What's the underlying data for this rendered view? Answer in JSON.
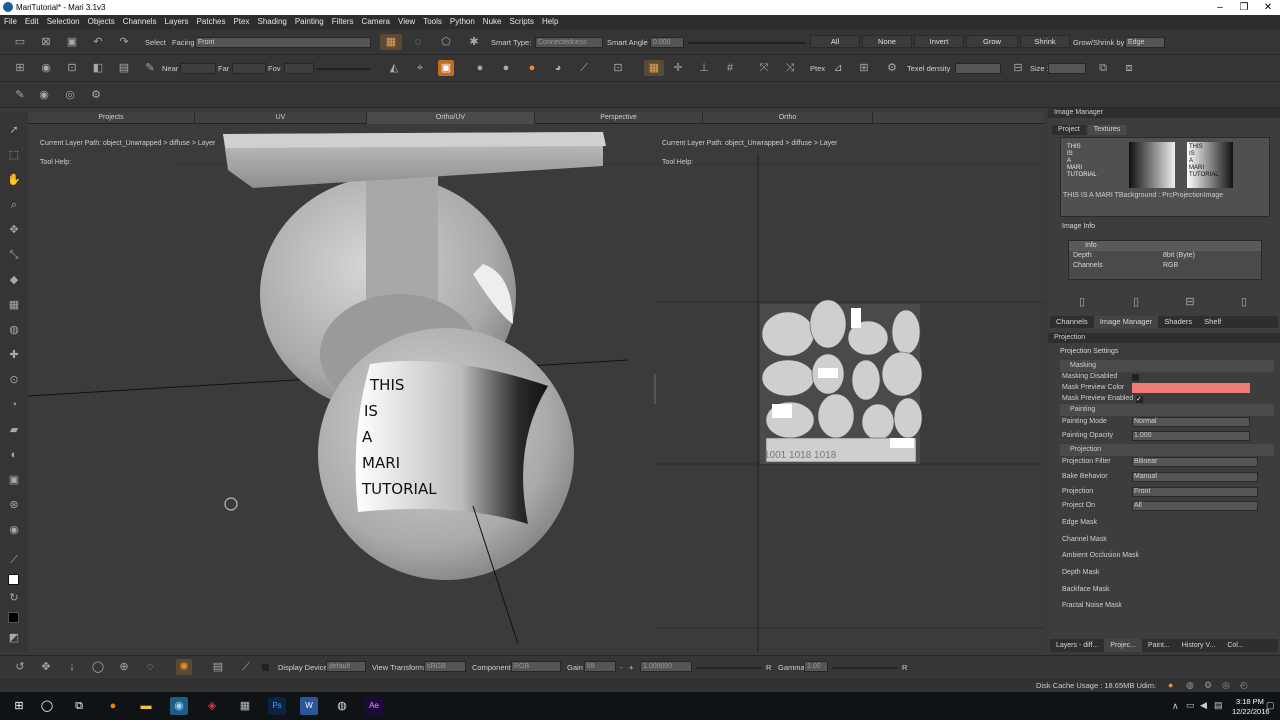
{
  "window": {
    "title": "MariTutorial* - Mari 3.1v3",
    "controls": [
      "minimize-icon",
      "maximize-icon",
      "close-icon"
    ]
  },
  "menu": [
    "File",
    "Edit",
    "Selection",
    "Objects",
    "Channels",
    "Layers",
    "Patches",
    "Ptex",
    "Shading",
    "Painting",
    "Filters",
    "Camera",
    "View",
    "Tools",
    "Python",
    "Nuke",
    "Scripts",
    "Help"
  ],
  "toolbar1": {
    "select_label": "Select",
    "facing_label": "Facing",
    "facing_value": "Front",
    "smart_type_label": "Smart Type:",
    "smart_type_value": "Connectedness",
    "smart_angle_label": "Smart Angle",
    "smart_angle_value": "0.000",
    "buttons": [
      "All",
      "None",
      "Invert",
      "Grow",
      "Shrink"
    ],
    "grow_shrink_label": "Grow/Shrink by",
    "grow_shrink_value": "Edge"
  },
  "toolbar2": {
    "near_label": "Near",
    "far_label": "Far",
    "fov_label": "Fov",
    "ptex_label": "Ptex",
    "texel_label": "Texel density",
    "size_label": "Size :"
  },
  "view_tabs": [
    "Projects",
    "UV",
    "Ortho/UV",
    "Perspective",
    "Ortho"
  ],
  "viewport": {
    "left_path": "Current Layer Path: object_Unwrapped > diffuse > Layer",
    "left_help": "Tool Help:",
    "right_path": "Current Layer Path: object_Unwrapped > diffuse > Layer",
    "right_help": "Tool Help:",
    "decal_lines": [
      "THIS",
      "IS",
      "A",
      "MARI",
      "TUTORIAL"
    ],
    "uv_label": "1001 1018 1018"
  },
  "image_manager": {
    "title": "Image Manager",
    "tabs": [
      "Project",
      "Textures"
    ],
    "thumb_text": [
      "THIS",
      "IS",
      "A",
      "MARI",
      "TUTORIAL"
    ],
    "caption": "THIS IS A MARI TBackground : PrcProjectionImage",
    "info_title": "Image Info",
    "info_group": "Info",
    "info_rows": [
      {
        "k": "Depth",
        "v": "8bit (Byte)"
      },
      {
        "k": "Channels",
        "v": "RGB"
      }
    ]
  },
  "panel_tabs": [
    "Channels",
    "Image Manager",
    "Shaders",
    "Shelf"
  ],
  "projection": {
    "title": "Projection",
    "settings_label": "Projection Settings",
    "masking_group": "Masking",
    "masking_disabled": "Masking Disabled",
    "mask_preview_color": "Mask Preview Color",
    "mask_preview_color_hex": "#f07a7a",
    "mask_preview_enabled": "Mask Preview Enabled",
    "painting_group": "Painting",
    "painting_mode_label": "Painting Mode",
    "painting_mode_value": "Normal",
    "painting_opacity_label": "Painting Opacity",
    "painting_opacity_value": "1.000",
    "projection_group": "Projection",
    "proj_filter_label": "Projection Filter",
    "proj_filter_value": "Bilinear",
    "bake_label": "Bake Behavior",
    "bake_value": "Manual",
    "projection_label": "Projection",
    "projection_value": "Front",
    "project_on_label": "Project On",
    "project_on_value": "All",
    "masks": [
      "Edge Mask",
      "Channel Mask",
      "Ambient Occlusion Mask",
      "Depth Mask",
      "Backface Mask",
      "Fractal Noise Mask"
    ]
  },
  "bottom_tabs": [
    "Layers - diff...",
    "Projec...",
    "Paint...",
    "History V...",
    "Col..."
  ],
  "bottombar": {
    "display_device_label": "Display Device",
    "display_device_value": "default",
    "view_transform_label": "View Transform",
    "view_transform_value": "sRGB",
    "component_label": "Component",
    "component_value": "RGB",
    "gain_label": "Gain",
    "gain_value": "f/8",
    "gain_num": "1.000000",
    "gamma_label": "Gamma",
    "gamma_value": "1.00"
  },
  "status": {
    "disk_cache": "Disk Cache Usage : 18.65MB  Udim:"
  },
  "taskbar": {
    "time": "3:18 PM",
    "date": "12/22/2016"
  }
}
